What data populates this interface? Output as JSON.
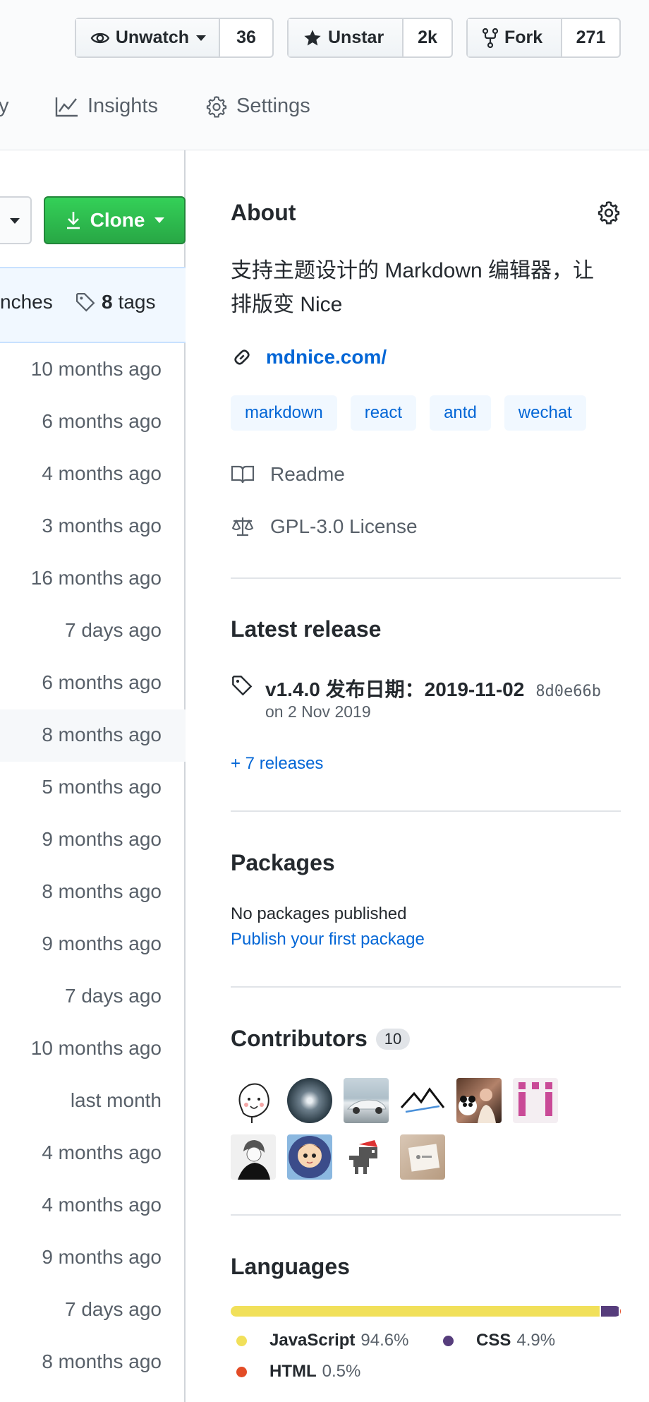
{
  "header": {
    "watch": {
      "label": "Unwatch",
      "count": "36"
    },
    "star": {
      "label": "Unstar",
      "count": "2k"
    },
    "fork": {
      "label": "Fork",
      "count": "271"
    },
    "nav": {
      "partial": "y",
      "insights": "Insights",
      "settings": "Settings"
    }
  },
  "repo": {
    "clone_label": "Clone",
    "branches_partial": "nches",
    "tags_count": "8",
    "tags_label": "tags",
    "rows": [
      "10 months ago",
      "6 months ago",
      "4 months ago",
      "3 months ago",
      "16 months ago",
      "7 days ago",
      "6 months ago",
      "8 months ago",
      "5 months ago",
      "9 months ago",
      "8 months ago",
      "9 months ago",
      "7 days ago",
      "10 months ago",
      "last month",
      "4 months ago",
      "4 months ago",
      "9 months ago",
      "7 days ago",
      "8 months ago"
    ]
  },
  "about": {
    "title": "About",
    "description_line1": "支持主题设计的 Markdown 编辑器，让",
    "description_line2": "排版变 Nice",
    "website": "mdnice.com/",
    "topics": [
      "markdown",
      "react",
      "antd",
      "wechat"
    ],
    "readme": "Readme",
    "license": "GPL-3.0 License"
  },
  "release": {
    "title": "Latest release",
    "name": "v1.4.0 发布日期：2019-11-02",
    "commit": "8d0e66b",
    "date": "on 2 Nov 2019",
    "more": "+ 7 releases"
  },
  "packages": {
    "title": "Packages",
    "none": "No packages published",
    "link": "Publish your first package"
  },
  "contributors": {
    "title": "Contributors",
    "count": "10"
  },
  "languages": {
    "title": "Languages",
    "items": [
      {
        "name": "JavaScript",
        "percent": "94.6%",
        "value": 94.6,
        "color": "#f1e05a"
      },
      {
        "name": "CSS",
        "percent": "4.9%",
        "value": 4.9,
        "color": "#563d7c"
      },
      {
        "name": "HTML",
        "percent": "0.5%",
        "value": 0.5,
        "color": "#e34c26"
      }
    ]
  },
  "colors": {
    "link": "#0366d6",
    "clone_green": "#28a745"
  }
}
